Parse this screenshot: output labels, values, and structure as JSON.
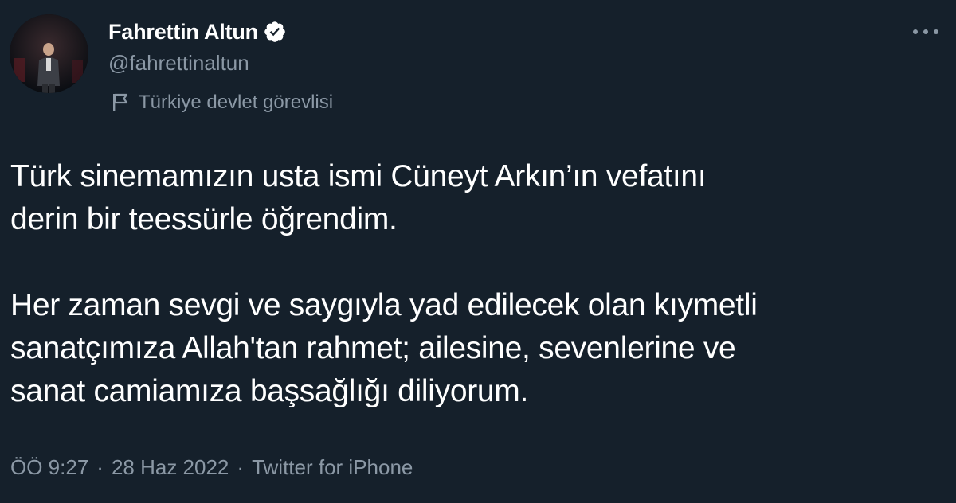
{
  "tweet": {
    "author": {
      "display_name": "Fahrettin Altun",
      "handle": "@fahrettinaltun",
      "verified_icon": "verified-badge-icon",
      "label": "Türkiye devlet görevlisi",
      "label_icon": "flag-icon"
    },
    "more_icon": "more-dots-icon",
    "text": {
      "paragraph_1_line_1": "Türk sinemamızın usta ismi Cüneyt Arkın’ın vefatını",
      "paragraph_1_line_2": "derin bir teessürle öğrendim.",
      "paragraph_2_line_1": "Her zaman sevgi ve saygıyla yad edilecek olan kıymetli",
      "paragraph_2_line_2": "sanatçımıza Allah'tan rahmet; ailesine, sevenlerine ve",
      "paragraph_2_line_3": "sanat camiamıza başsağlığı diliyorum."
    },
    "meta": {
      "time": "ÖÖ 9:27",
      "separator": "·",
      "date": "28 Haz 2022",
      "source": "Twitter for iPhone"
    }
  },
  "colors": {
    "background": "#15202b",
    "text_primary": "#ffffff",
    "text_secondary": "#8b98a5",
    "verified_badge": "#ffffff"
  }
}
